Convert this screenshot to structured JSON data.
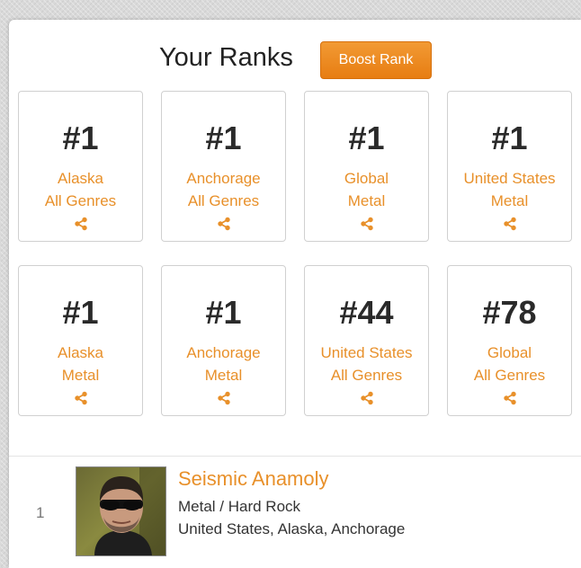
{
  "header": {
    "title": "Your Ranks",
    "boost_label": "Boost Rank"
  },
  "colors": {
    "accent": "#e8902a",
    "button_top": "#f29a34",
    "button_bottom": "#e77d12"
  },
  "ranks": [
    {
      "rank": "#1",
      "region": "Alaska",
      "genre": "All Genres",
      "icon": "share-icon"
    },
    {
      "rank": "#1",
      "region": "Anchorage",
      "genre": "All Genres",
      "icon": "share-icon"
    },
    {
      "rank": "#1",
      "region": "Global",
      "genre": "Metal",
      "icon": "share-icon"
    },
    {
      "rank": "#1",
      "region": "United States",
      "genre": "Metal",
      "icon": "share-icon"
    },
    {
      "rank": "#1",
      "region": "Alaska",
      "genre": "Metal",
      "icon": "share-icon"
    },
    {
      "rank": "#1",
      "region": "Anchorage",
      "genre": "Metal",
      "icon": "share-icon"
    },
    {
      "rank": "#44",
      "region": "United States",
      "genre": "All Genres",
      "icon": "share-icon"
    },
    {
      "rank": "#78",
      "region": "Global",
      "genre": "All Genres",
      "icon": "share-icon"
    }
  ],
  "artist": {
    "position": "1",
    "name": "Seismic Anamoly",
    "genre": "Metal / Hard Rock",
    "location": "United States, Alaska, Anchorage"
  }
}
